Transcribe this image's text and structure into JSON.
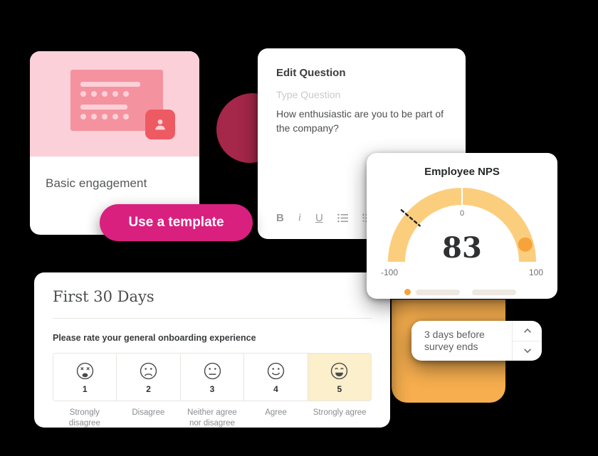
{
  "template_card": {
    "title": "Basic engagement",
    "illustration_icon": "person-badge-icon",
    "dot_count": 5
  },
  "use_template_button": {
    "label": "Use a template"
  },
  "edit_question_card": {
    "title": "Edit Question",
    "placeholder": "Type Question",
    "question_text": "How enthusiastic are you to be part of the company?",
    "toolbar": [
      {
        "name": "bold",
        "label": "B"
      },
      {
        "name": "italic",
        "label": "i"
      },
      {
        "name": "underline",
        "label": "U"
      },
      {
        "name": "bullet-list",
        "label": ""
      },
      {
        "name": "numbered-list",
        "label": ""
      }
    ]
  },
  "nps_card": {
    "title": "Employee NPS",
    "value": "83",
    "min_label": "-100",
    "mid_label": "0",
    "max_label": "100",
    "accent_color": "#F7A33B",
    "arc_color": "#FBCE7E"
  },
  "chart_data": {
    "type": "gauge",
    "title": "Employee NPS",
    "value": 83,
    "min": -100,
    "max": 100,
    "ticks": [
      -100,
      0,
      100
    ],
    "tick_labels": [
      "-100",
      "0",
      "100"
    ],
    "marker_value": 83,
    "marker_color": "#F7A33B",
    "arc_color": "#FBCE7E",
    "needle_value": -55,
    "needle_style": "dashed",
    "grid": false,
    "legend": "bottom"
  },
  "survey_card": {
    "title": "First 30 Days",
    "question": "Please rate your general onboarding experience",
    "selected_value": 5,
    "options": [
      {
        "value": "1",
        "label": "Strongly disagree",
        "face": "face-very-sad-icon"
      },
      {
        "value": "2",
        "label": "Disagree",
        "face": "face-sad-icon"
      },
      {
        "value": "3",
        "label": "Neither agree nor disagree",
        "face": "face-neutral-icon"
      },
      {
        "value": "4",
        "label": "Agree",
        "face": "face-happy-icon"
      },
      {
        "value": "5",
        "label": "Strongly agree",
        "face": "face-very-happy-icon"
      }
    ]
  },
  "stepper": {
    "text": "3 days before survey ends",
    "increment_icon": "chevron-up-icon",
    "decrement_icon": "chevron-down-icon"
  }
}
